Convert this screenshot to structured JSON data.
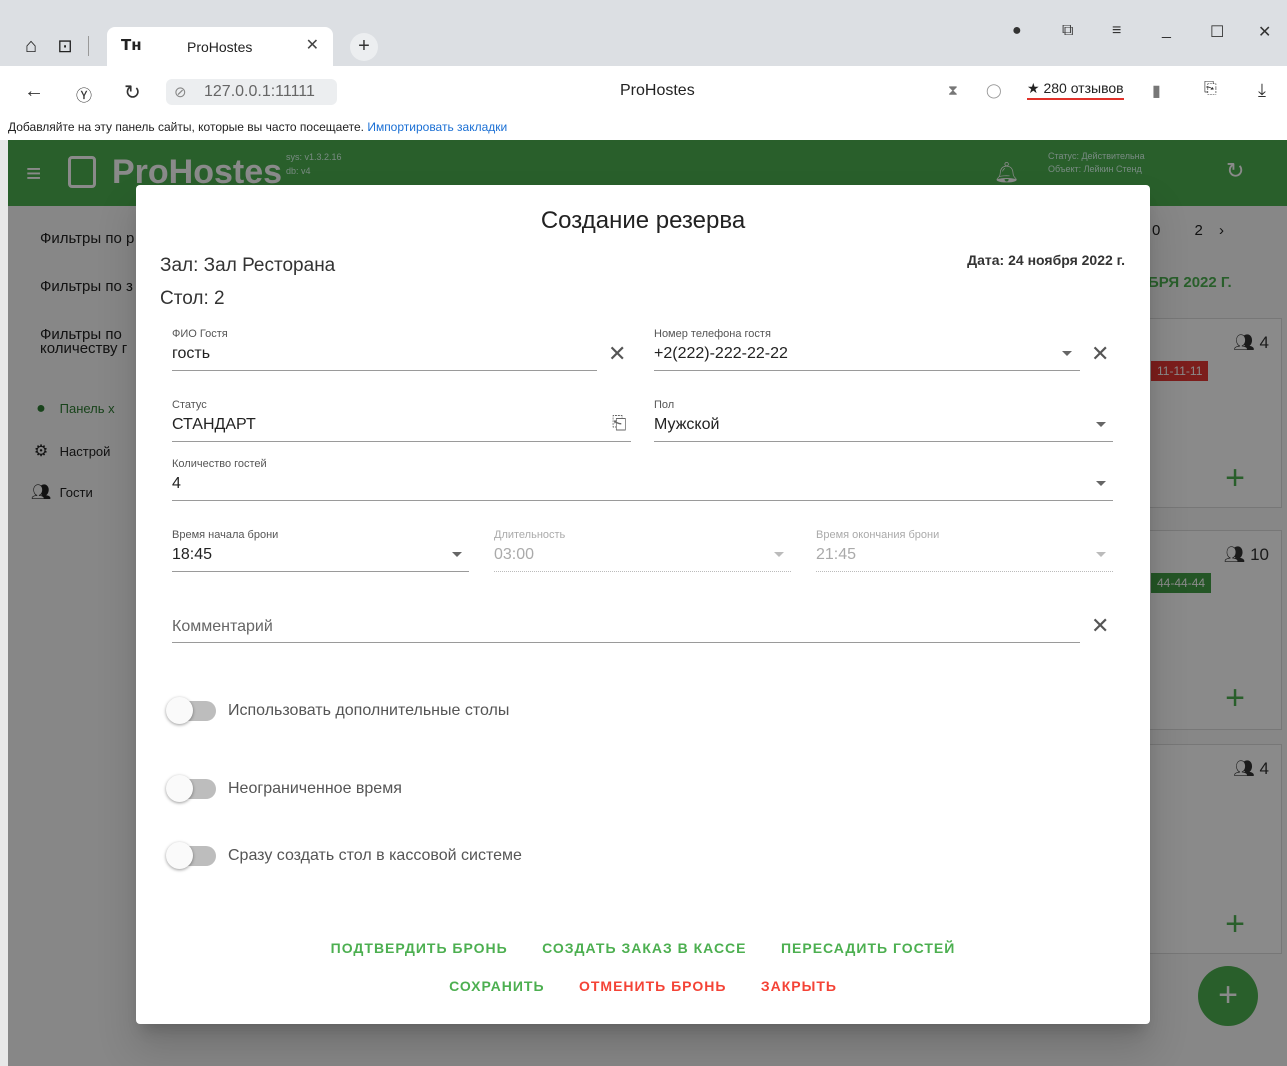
{
  "browser": {
    "tab_favicon": "Тн",
    "tab_title": "ProHostes",
    "new_tab": "+",
    "address": "127.0.0.1:11111",
    "page_title": "ProHostes",
    "reviews": "280 отзывов",
    "bookmarks_hint": "Добавляйте на эту панель сайты, которые вы часто посещаете.",
    "bookmarks_import": "Импортировать закладки"
  },
  "app": {
    "logo": "ProHostes",
    "version_sys": "sys: v1.3.2.16",
    "version_db": "db: v4",
    "status_line": "Статус: Действительна",
    "object_line": "Объект: Лейкин Стенд",
    "pager_num1": "0",
    "pager_num2": "2",
    "date_header": "БРЯ 2022 Г.",
    "filters": [
      "Фильтры по р",
      "Фильтры по з",
      "Фильтры по",
      "количеству г"
    ],
    "sidebar": [
      {
        "label": "Панель х",
        "icon": "clock-icon"
      },
      {
        "label": "Настрой",
        "icon": "gear-icon"
      },
      {
        "label": "Гости",
        "icon": "people-icon"
      }
    ],
    "cards": [
      {
        "guests": "4",
        "chip": "11-11-11",
        "chip_color": "#e53935"
      },
      {
        "guests": "10",
        "chip": "44-44-44",
        "chip_color": "#43a047"
      },
      {
        "guests": "4",
        "chip": "",
        "chip_color": ""
      }
    ]
  },
  "dialog": {
    "title": "Создание резерва",
    "hall": "Зал: Зал Ресторана",
    "table": "Стол: 2",
    "date": "Дата: 24 ноября 2022 г.",
    "fields": {
      "guest_name": {
        "label": "ФИО Гостя",
        "value": "гость"
      },
      "phone": {
        "label": "Номер телефона гостя",
        "value": "+2(222)-222-22-22"
      },
      "status": {
        "label": "Статус",
        "value": "СТАНДАРТ"
      },
      "gender": {
        "label": "Пол",
        "value": "Мужской"
      },
      "guest_count": {
        "label": "Количество гостей",
        "value": "4"
      },
      "start_time": {
        "label": "Время начала брони",
        "value": "18:45"
      },
      "duration": {
        "label": "Длительность",
        "value": "03:00"
      },
      "end_time": {
        "label": "Время окончания брони",
        "value": "21:45"
      },
      "comment": {
        "placeholder": "Комментарий"
      }
    },
    "toggles": {
      "extra_tables": "Использовать дополнительные столы",
      "unlimited_time": "Неограниченное время",
      "create_in_pos": "Сразу создать стол в кассовой системе"
    },
    "actions": {
      "confirm": "ПОДТВЕРДИТЬ БРОНЬ",
      "create_order": "СОЗДАТЬ ЗАКАЗ В КАССЕ",
      "reseat": "ПЕРЕСАДИТЬ ГОСТЕЙ",
      "save": "СОХРАНИТЬ",
      "cancel_booking": "ОТМЕНИТЬ БРОНЬ",
      "close": "ЗАКРЫТЬ"
    },
    "colors": {
      "accent": "#4caf50",
      "danger": "#f44336"
    }
  }
}
